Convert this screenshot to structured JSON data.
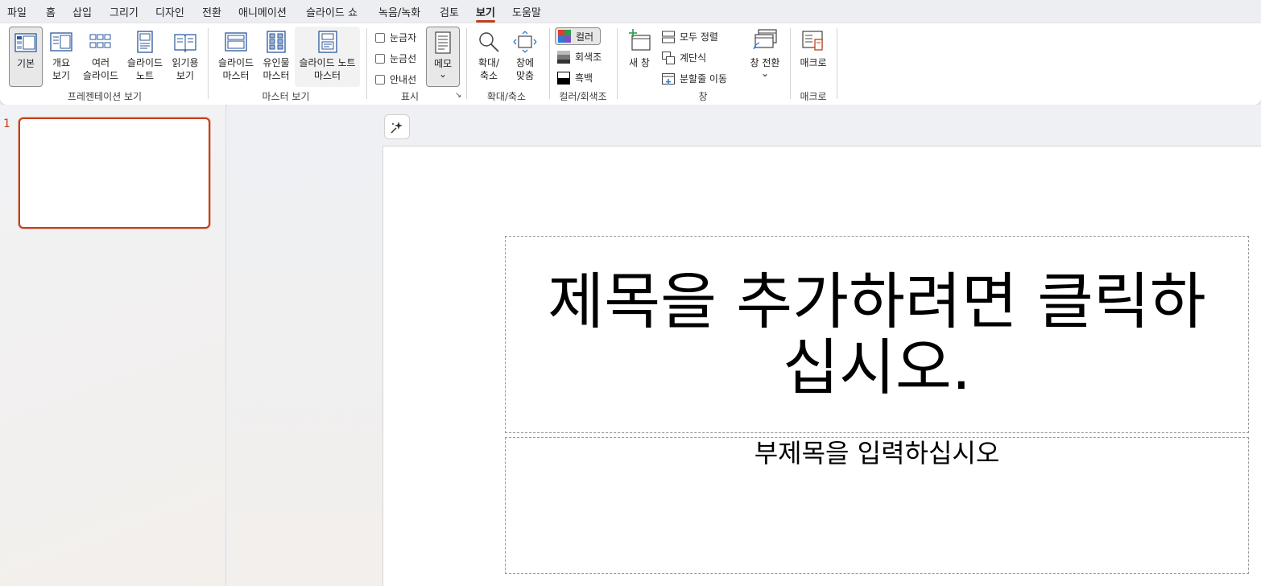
{
  "menu": {
    "tabs": [
      "파일",
      "홈",
      "삽입",
      "그리기",
      "디자인",
      "전환",
      "애니메이션",
      "슬라이드 쇼",
      "녹음/녹화",
      "검토",
      "보기",
      "도움말"
    ],
    "active_tab": "보기",
    "accent_color": "#c43e1c"
  },
  "ribbon": {
    "presentation_views": {
      "label": "프레젠테이션 보기",
      "buttons": [
        {
          "line1": "기본",
          "line2": ""
        },
        {
          "line1": "개요",
          "line2": "보기"
        },
        {
          "line1": "여러",
          "line2": "슬라이드"
        },
        {
          "line1": "슬라이드",
          "line2": "노트"
        },
        {
          "line1": "읽기용",
          "line2": "보기"
        }
      ]
    },
    "master_views": {
      "label": "마스터 보기",
      "buttons": [
        {
          "line1": "슬라이드",
          "line2": "마스터"
        },
        {
          "line1": "유인물",
          "line2": "마스터"
        },
        {
          "line1": "슬라이드 노트",
          "line2": "마스터"
        }
      ]
    },
    "show": {
      "label": "표시",
      "checkboxes": [
        "눈금자",
        "눈금선",
        "안내선"
      ],
      "notes_button": "메모",
      "dropdown_glyph": "⌄",
      "launcher_glyph": "↘"
    },
    "zoom": {
      "label": "확대/축소",
      "zoom_button": {
        "line1": "확대/",
        "line2": "축소"
      },
      "fit_button": {
        "line1": "창에",
        "line2": "맞춤"
      }
    },
    "color": {
      "label": "컬러/회색조",
      "options": [
        "컬러",
        "회색조",
        "흑백"
      ],
      "selected": "컬러"
    },
    "window": {
      "label": "창",
      "new_window": "새 창",
      "arrange_all": "모두 정렬",
      "cascade": "계단식",
      "move_split": "분할줄 이동",
      "switch_windows": "창 전환",
      "dropdown_glyph": "⌄"
    },
    "macros": {
      "label": "매크로",
      "button": "매크로"
    }
  },
  "thumbnails": [
    {
      "number": "1"
    }
  ],
  "slide": {
    "title_placeholder": "제목을 추가하려면 클릭하십시오.",
    "subtitle_placeholder": "부제목을 입력하십시오"
  }
}
